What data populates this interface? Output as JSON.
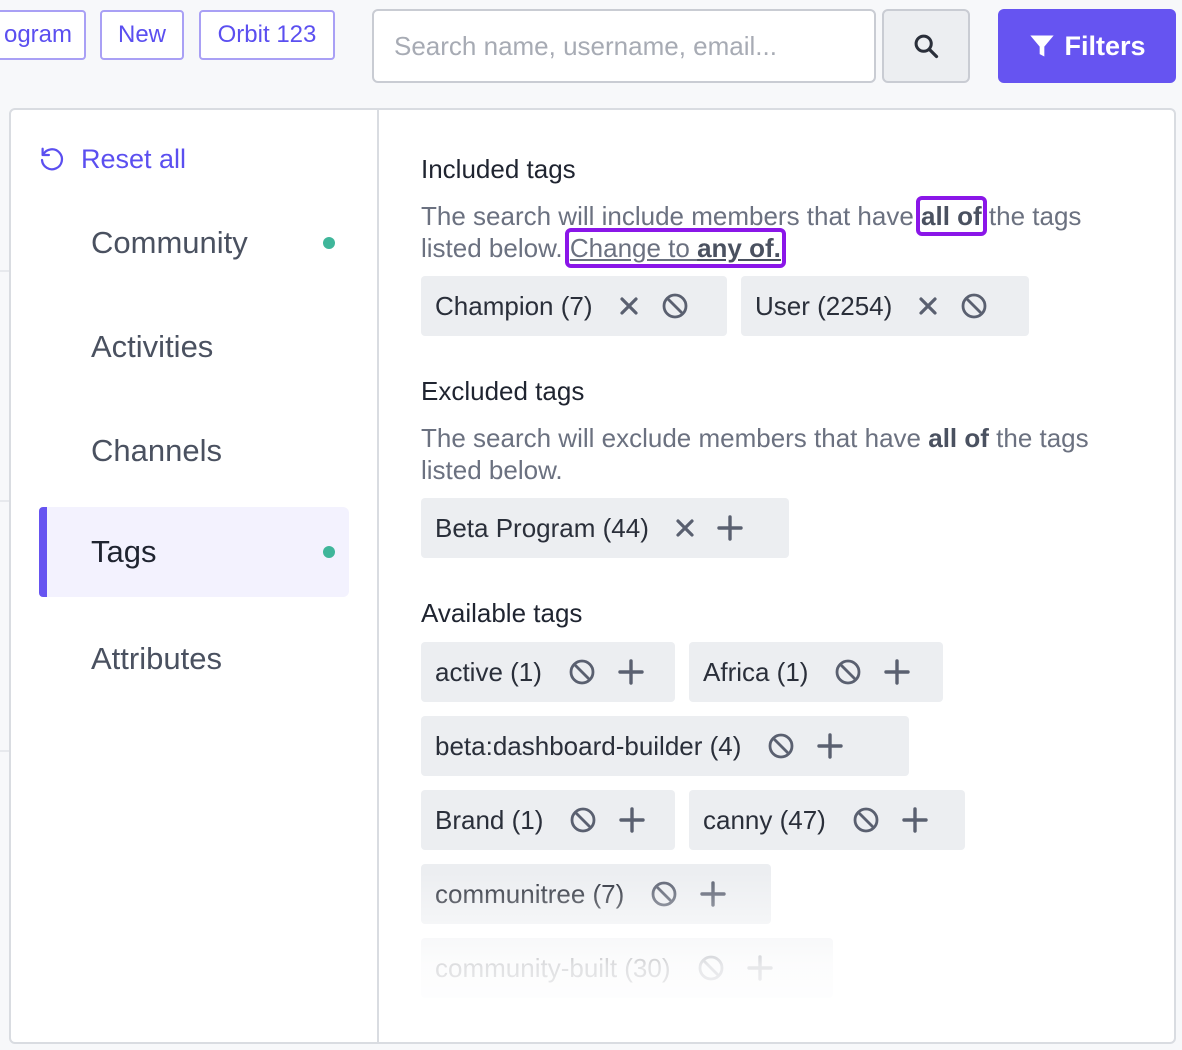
{
  "topbar": {
    "chips": [
      "ogram",
      "New",
      "Orbit 123"
    ],
    "search_placeholder": "Search name, username, email...",
    "filters_label": "Filters"
  },
  "sidebar": {
    "reset_label": "Reset all",
    "items": [
      {
        "label": "Community",
        "has_dot": true,
        "active": false
      },
      {
        "label": "Activities",
        "has_dot": false,
        "active": false
      },
      {
        "label": "Channels",
        "has_dot": false,
        "active": false
      },
      {
        "label": "Tags",
        "has_dot": true,
        "active": true
      },
      {
        "label": "Attributes",
        "has_dot": false,
        "active": false
      }
    ]
  },
  "included": {
    "title": "Included tags",
    "desc_pre": "The search will include members that have ",
    "desc_bold": "all of",
    "desc_post": " the tags listed below. ",
    "change_pre": "Change to ",
    "change_bold": "any of.",
    "tags": [
      "Champion (7)",
      "User (2254)"
    ]
  },
  "excluded": {
    "title": "Excluded tags",
    "desc_pre": "The search will exclude members that have ",
    "desc_bold": "all of",
    "desc_post": " the tags listed below.",
    "tags": [
      "Beta Program (44)"
    ]
  },
  "available": {
    "title": "Available tags",
    "tags": [
      "active (1)",
      "Africa (1)",
      "beta:dashboard-builder (4)",
      "Brand (1)",
      "canny (47)",
      "communitree (7)",
      "community-built (30)"
    ]
  },
  "colors": {
    "accent": "#6654f1",
    "highlight": "#8a16e8",
    "dot": "#3fb69a"
  }
}
